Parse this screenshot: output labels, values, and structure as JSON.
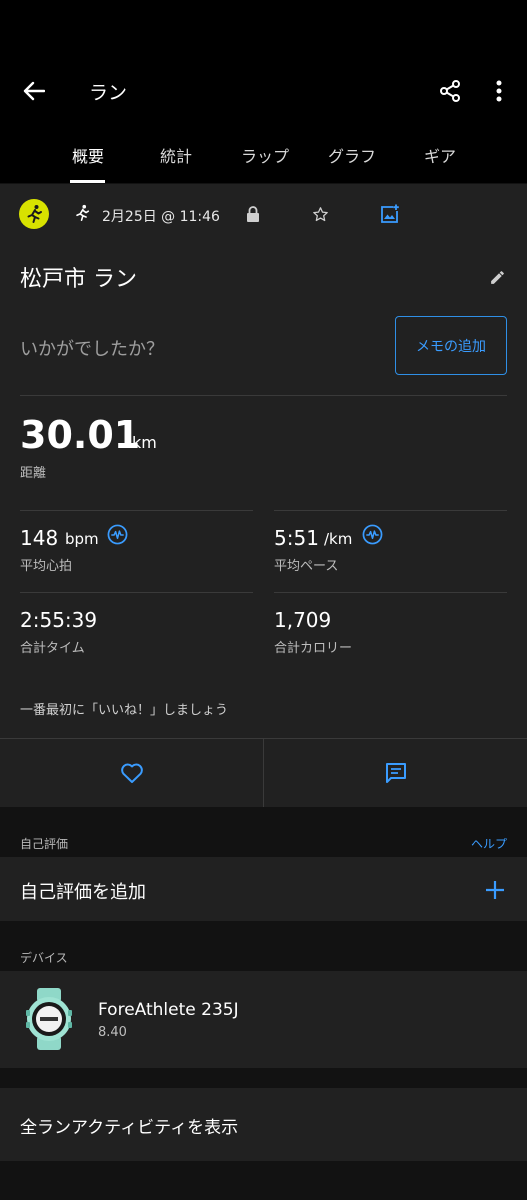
{
  "header": {
    "title": "ラン",
    "back_icon": "arrow-left-icon",
    "share_icon": "share-icon",
    "menu_icon": "more-vert-icon"
  },
  "tabs": [
    {
      "label": "概要",
      "active": true
    },
    {
      "label": "統計",
      "active": false
    },
    {
      "label": "ラップ",
      "active": false
    },
    {
      "label": "グラフ",
      "active": false
    },
    {
      "label": "ギア",
      "active": false
    }
  ],
  "activity": {
    "date": "2月25日 @ 11:46",
    "title": "松戸市 ラン",
    "question": "いかがでしたか？",
    "memo_button": "メモの追加",
    "icon_color": "#d8e200"
  },
  "stats": {
    "distance": {
      "value": "30.01",
      "unit": "km",
      "label": "距離"
    },
    "heart_rate": {
      "value": "148",
      "unit": "bpm",
      "label": "平均心拍"
    },
    "pace": {
      "value": "5:51",
      "unit": "/km",
      "label": "平均ペース"
    },
    "time": {
      "value": "2:55:39",
      "label": "合計タイム"
    },
    "calories": {
      "value": "1,709",
      "label": "合計カロリー"
    }
  },
  "like_prompt": "一番最初に「いいね！」しましょう",
  "self_eval": {
    "section_label": "自己評価",
    "help_link": "ヘルプ",
    "add_label": "自己評価を追加"
  },
  "devices": {
    "section_label": "デバイス",
    "name": "ForeAthlete 235J",
    "version": "8.40"
  },
  "all_activities": "全ランアクティビティを表示",
  "colors": {
    "accent": "#3a9cff",
    "background": "#121212",
    "card": "#212121"
  }
}
